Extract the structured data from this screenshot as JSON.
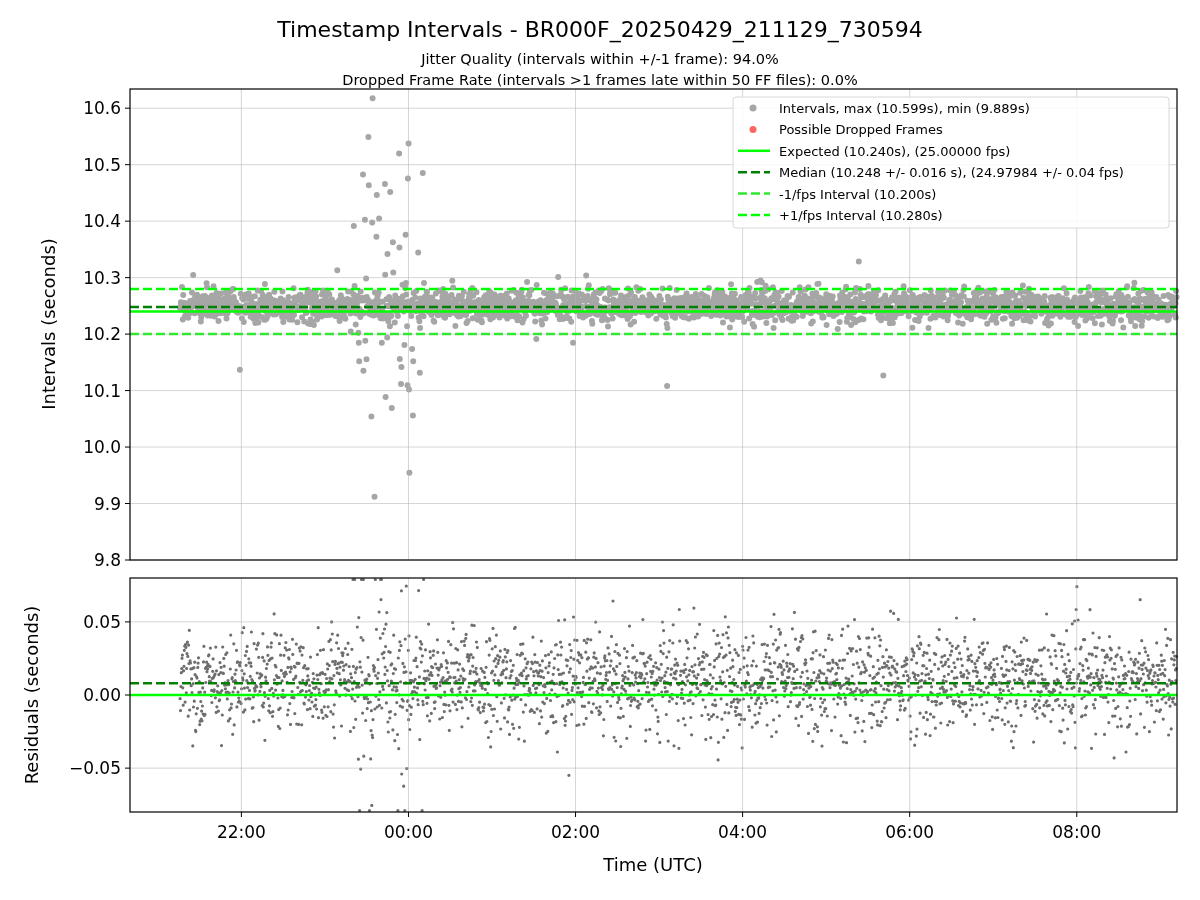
{
  "figure": {
    "title": "Timestamp Intervals - BR000F_20250429_211129_730594",
    "subtitles": [
      "Jitter Quality (intervals within +/-1 frame): 94.0%",
      "Dropped Frame Rate (intervals >1 frames late within 50 FF files): 0.0%"
    ]
  },
  "top": {
    "legend_markers": [
      {
        "label": "Intervals, max (10.599s), min (9.889s)",
        "color": "#a6a6a6"
      },
      {
        "label": "Possible Dropped Frames",
        "color": "#ff6666"
      }
    ],
    "chart_data": {
      "type": "line",
      "ylabel": "Intervals (seconds)",
      "grid": true,
      "legend": "upper right",
      "xlim": [
        "2025-04-29T20:40",
        "2025-04-30T09:12"
      ],
      "ylim": [
        9.8,
        10.634
      ],
      "yticks": [
        9.8,
        9.9,
        {
          "value": 10.0,
          "label": "10.0"
        },
        10.1,
        10.2,
        10.3,
        10.4,
        10.5,
        10.6
      ],
      "x": [
        "2025-04-29T20:40",
        "2025-04-30T09:12"
      ],
      "series": [
        {
          "name": "Expected (10.240s), (25.00000 fps)",
          "color": "#00ff00",
          "line_style": "solid",
          "values": [
            10.24,
            10.24
          ]
        },
        {
          "name": "Median (10.248 +/- 0.016 s), (24.97984 +/- 0.04 fps)",
          "color": "#008000",
          "line_style": "dashed",
          "values": [
            10.248,
            10.248
          ]
        },
        {
          "name": "-1/fps Interval (10.200s)",
          "color": "#32e632",
          "line_style": "dashed",
          "values": [
            10.2,
            10.2
          ]
        },
        {
          "name": "+1/fps Interval (10.280s)",
          "color": "#00ff00",
          "line_style": "dashed",
          "values": [
            10.28,
            10.28
          ]
        }
      ]
    }
  },
  "bottom": {
    "chart_data": {
      "type": "line",
      "xlabel": "Time (UTC)",
      "ylabel": "Residuals (seconds)",
      "grid": true,
      "xlim": [
        "2025-04-29T20:40",
        "2025-04-30T09:12"
      ],
      "ylim": [
        -0.08,
        0.08
      ],
      "xticks": [
        {
          "value": "2025-04-29T22:00",
          "label": "22:00"
        },
        {
          "value": "2025-04-30T00:00",
          "label": "00:00"
        },
        {
          "value": "2025-04-30T02:00",
          "label": "02:00"
        },
        {
          "value": "2025-04-30T04:00",
          "label": "04:00"
        },
        {
          "value": "2025-04-30T06:00",
          "label": "06:00"
        },
        {
          "value": "2025-04-30T08:00",
          "label": "08:00"
        }
      ],
      "yticks": [
        {
          "value": -0.05,
          "label": "−0.05"
        },
        {
          "value": 0,
          "label": "0.00"
        },
        {
          "value": 0.05,
          "label": "0.05"
        }
      ],
      "x": [
        "2025-04-29T20:40",
        "2025-04-30T09:12"
      ],
      "series": [
        {
          "color": "#00ff00",
          "line_style": "solid",
          "values": [
            0,
            0
          ]
        },
        {
          "color": "#008000",
          "line_style": "dashed",
          "values": [
            0.008,
            0.008
          ]
        }
      ]
    }
  }
}
